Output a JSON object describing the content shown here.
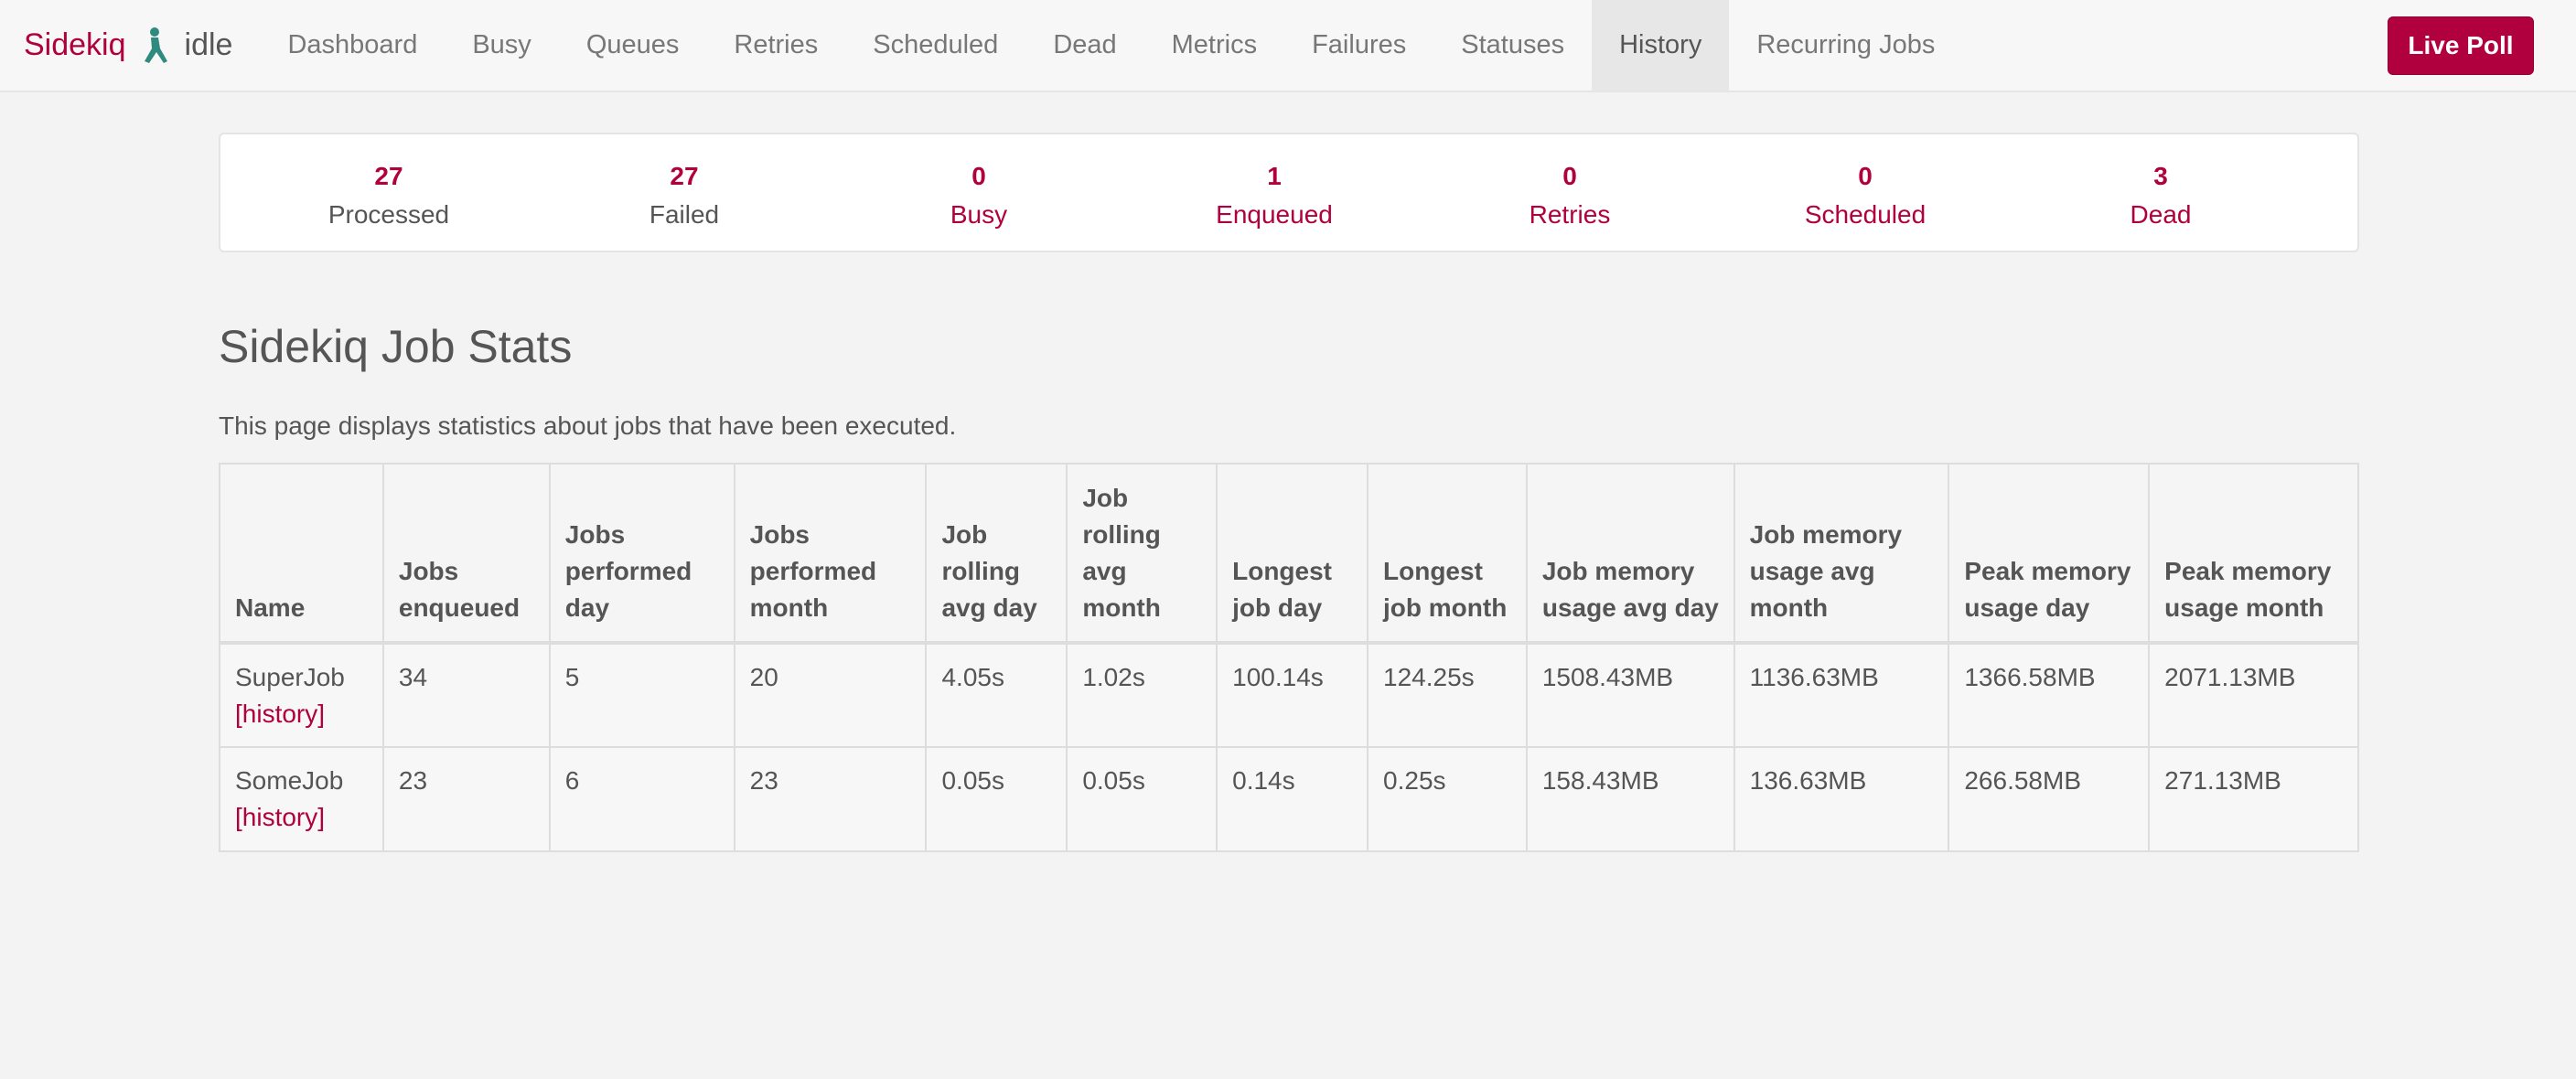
{
  "navbar": {
    "brand": "Sidekiq",
    "status": "idle",
    "items": [
      {
        "label": "Dashboard"
      },
      {
        "label": "Busy"
      },
      {
        "label": "Queues"
      },
      {
        "label": "Retries"
      },
      {
        "label": "Scheduled"
      },
      {
        "label": "Dead"
      },
      {
        "label": "Metrics"
      },
      {
        "label": "Failures"
      },
      {
        "label": "Statuses"
      },
      {
        "label": "History",
        "active": true
      },
      {
        "label": "Recurring Jobs"
      }
    ],
    "live_poll": "Live Poll"
  },
  "summary": {
    "processed": {
      "value": "27",
      "label": "Processed"
    },
    "failed": {
      "value": "27",
      "label": "Failed"
    },
    "busy": {
      "value": "0",
      "label": "Busy"
    },
    "enqueued": {
      "value": "1",
      "label": "Enqueued"
    },
    "retries": {
      "value": "0",
      "label": "Retries"
    },
    "scheduled": {
      "value": "0",
      "label": "Scheduled"
    },
    "dead": {
      "value": "3",
      "label": "Dead"
    }
  },
  "page": {
    "title": "Sidekiq Job Stats",
    "description": "This page displays statistics about jobs that have been executed."
  },
  "table": {
    "headers": [
      "Name",
      "Jobs enqueued",
      "Jobs performed day",
      "Jobs performed month",
      "Job rolling avg day",
      "Job rolling avg month",
      "Longest job day",
      "Longest job month",
      "Job memory usage avg day",
      "Job memory usage avg month",
      "Peak memory usage day",
      "Peak memory usage month"
    ],
    "rows": [
      {
        "name": "SuperJob",
        "history_link": "[history]",
        "enqueued": "34",
        "performed_day": "5",
        "performed_month": "20",
        "rolling_avg_day": "4.05s",
        "rolling_avg_month": "1.02s",
        "longest_day": "100.14s",
        "longest_month": "124.25s",
        "mem_avg_day": "1508.43MB",
        "mem_avg_month": "1136.63MB",
        "peak_mem_day": "1366.58MB",
        "peak_mem_month": "2071.13MB"
      },
      {
        "name": "SomeJob",
        "history_link": "[history]",
        "enqueued": "23",
        "performed_day": "6",
        "performed_month": "23",
        "rolling_avg_day": "0.05s",
        "rolling_avg_month": "0.05s",
        "longest_day": "0.14s",
        "longest_month": "0.25s",
        "mem_avg_day": "158.43MB",
        "mem_avg_month": "136.63MB",
        "peak_mem_day": "266.58MB",
        "peak_mem_month": "271.13MB"
      }
    ]
  },
  "colors": {
    "brand": "#b1003e",
    "text": "#555555",
    "background": "#f3f3f3"
  }
}
